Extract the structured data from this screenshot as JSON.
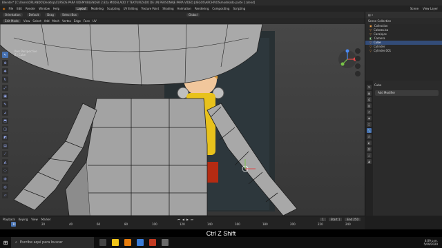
{
  "window": {
    "title": "Blender* [C:\\Users\\ORLANDO\\Desktop\\CURSOS PARA UDEMY\\BLENDER 2.82a MODELADO Y TEXTURIZADO DE UN PERSONAJE PARA VIDEO JUEGOS\\ARCHIVOS\\modelado parte 1.blend]"
  },
  "menu": {
    "items": [
      "File",
      "Edit",
      "Render",
      "Window",
      "Help"
    ],
    "workspaces": [
      "Layout",
      "Modeling",
      "Sculpting",
      "UV Editing",
      "Texture Paint",
      "Shading",
      "Animation",
      "Rendering",
      "Compositing",
      "Scripting"
    ],
    "active_workspace": "Layout",
    "scene": "Scene",
    "view_layer": "View Layer"
  },
  "tool_header": {
    "items": [
      "Orientation",
      "Default",
      "Drag",
      "Select Box"
    ],
    "transform": "Global"
  },
  "view_header": {
    "mode": "Edit Mode",
    "menus": [
      "View",
      "Select",
      "Add",
      "Mesh",
      "Vertex",
      "Edge",
      "Face",
      "UV"
    ]
  },
  "viewport": {
    "info_line1": "User Perspective",
    "info_line2": "(1) Cube"
  },
  "outliner": {
    "title": "Scene Collection",
    "rows": [
      {
        "label": "Collection",
        "icon": "collection-icon",
        "selected": false
      },
      {
        "label": "Cabeza.ba",
        "icon": "mesh-icon",
        "selected": false
      },
      {
        "label": "Cara/ojos",
        "icon": "mesh-icon",
        "selected": false
      },
      {
        "label": "Camera",
        "icon": "camera-icon",
        "selected": false
      },
      {
        "label": "Cube",
        "icon": "mesh-icon",
        "selected": true
      },
      {
        "label": "Cylinder",
        "icon": "mesh-icon",
        "selected": false
      },
      {
        "label": "Cylinder.001",
        "icon": "mesh-icon",
        "selected": false
      }
    ]
  },
  "properties": {
    "object_name": "Cube",
    "add_modifier": "Add Modifier"
  },
  "timeline": {
    "menus": [
      "Playback",
      "Keying",
      "View",
      "Marker"
    ],
    "current_frame": "1",
    "start": "Start 1",
    "end": "End 250",
    "ticks": [
      "0",
      "20",
      "40",
      "60",
      "80",
      "100",
      "120",
      "140",
      "160",
      "180",
      "200",
      "220",
      "240"
    ]
  },
  "caption": {
    "text": "Ctrl Z Shift"
  },
  "taskbar": {
    "search_placeholder": "Escribe aquí para buscar",
    "time": "4:09 p.m.",
    "date": "5/09/2020"
  },
  "colors": {
    "accent": "#4772b3",
    "viewport_bg": "#3d3d3d",
    "mesh": "#a9a9a9"
  }
}
